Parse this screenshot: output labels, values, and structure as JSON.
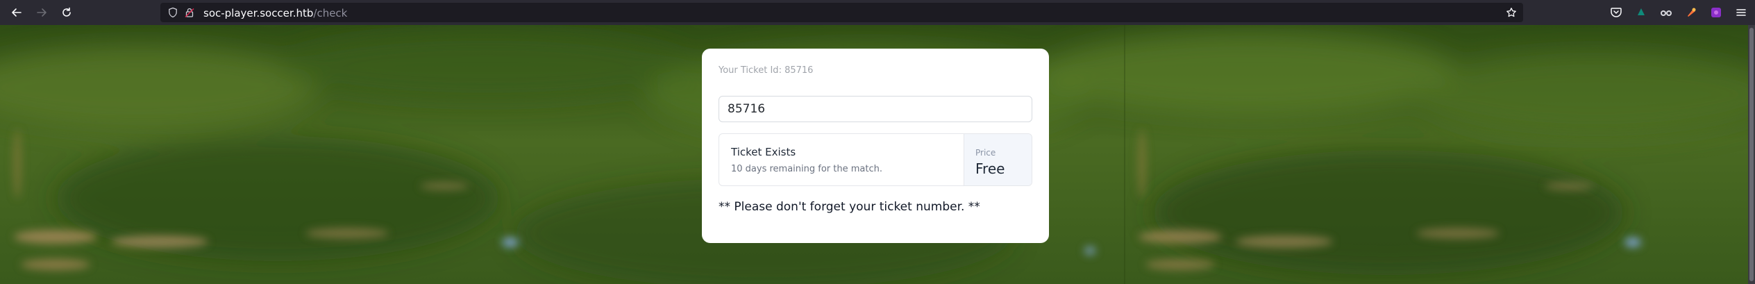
{
  "browser": {
    "url_host": "soc-player.soccer.htb",
    "url_path": "/check",
    "icons": [
      "back-arrow-icon",
      "forward-arrow-icon",
      "reload-icon",
      "shield-icon",
      "lock-icon",
      "bookmark-star-icon",
      "pocket-icon",
      "extension-icon",
      "extension-icon",
      "extension-icon",
      "extension-icon",
      "menu-icon"
    ]
  },
  "card": {
    "ticket_label": "Your Ticket Id: 85716",
    "ticket_input_value": "85716",
    "status_title": "Ticket Exists",
    "status_subtitle": "10 days remaining for the match.",
    "price_label": "Price",
    "price_value": "Free",
    "reminder": "** Please don't forget your ticket number. **"
  },
  "colors": {
    "chrome": "#2b2a33",
    "urlbar": "#1c1b22",
    "card_bg": "#ffffff",
    "price_panel": "#f3f6fb",
    "grass": "#3d5a1e"
  }
}
